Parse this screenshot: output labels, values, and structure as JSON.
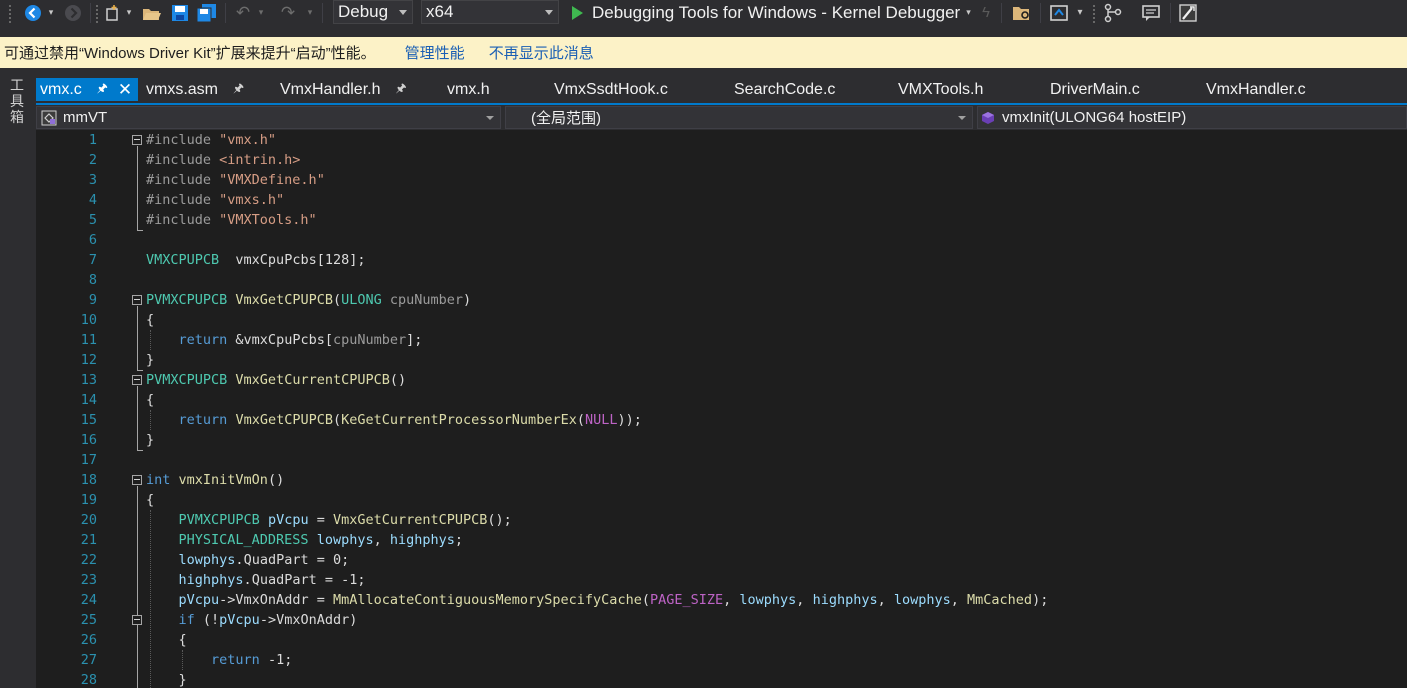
{
  "toolbar": {
    "config": "Debug",
    "platform": "x64",
    "debugger": "Debugging Tools for Windows - Kernel Debugger"
  },
  "infobar": {
    "message": "可通过禁用“Windows Driver Kit”扩展来提升“启动”性能。",
    "manage_link": "管理性能",
    "dismiss_link": "不再显示此消息"
  },
  "sidestrip": {
    "toolbox_label": "工具箱"
  },
  "tabs": [
    {
      "label": "vmx.c",
      "active": true
    },
    {
      "label": "vmxs.asm",
      "pinned": true
    },
    {
      "label": "VmxHandler.h",
      "pinned": true
    },
    {
      "label": "vmx.h"
    },
    {
      "label": "VmxSsdtHook.c"
    },
    {
      "label": "SearchCode.c"
    },
    {
      "label": "VMXTools.h"
    },
    {
      "label": "DriverMain.c"
    },
    {
      "label": "VmxHandler.c"
    }
  ],
  "navbar": {
    "project": "mmVT",
    "scope": "(全局范围)",
    "member": "vmxInit(ULONG64 hostEIP)"
  },
  "code": {
    "line_numbers": [
      "1",
      "2",
      "3",
      "4",
      "5",
      "6",
      "7",
      "8",
      "9",
      "10",
      "11",
      "12",
      "13",
      "14",
      "15",
      "16",
      "17",
      "18",
      "19",
      "20",
      "21",
      "22",
      "23",
      "24",
      "25",
      "26",
      "27",
      "28"
    ],
    "lines": [
      [
        [
          "pre",
          "#include "
        ],
        [
          "str",
          "\"vmx.h\""
        ]
      ],
      [
        [
          "pre",
          "#include "
        ],
        [
          "str",
          "<intrin.h>"
        ]
      ],
      [
        [
          "pre",
          "#include "
        ],
        [
          "str",
          "\"VMXDefine.h\""
        ]
      ],
      [
        [
          "pre",
          "#include "
        ],
        [
          "str",
          "\"vmxs.h\""
        ]
      ],
      [
        [
          "pre",
          "#include "
        ],
        [
          "str",
          "\"VMXTools.h\""
        ]
      ],
      [],
      [
        [
          "ty",
          "VMXCPUPCB"
        ],
        [
          "",
          "  "
        ],
        [
          "",
          "vmxCpuPcbs[128];"
        ]
      ],
      [],
      [
        [
          "ty",
          "PVMXCPUPCB"
        ],
        [
          "",
          " "
        ],
        [
          "fn",
          "VmxGetCPUPCB"
        ],
        [
          "",
          "("
        ],
        [
          "ty",
          "ULONG"
        ],
        [
          "",
          " "
        ],
        [
          "pre",
          "cpuNumber"
        ],
        [
          "",
          ")"
        ]
      ],
      [
        [
          "",
          "{"
        ]
      ],
      [
        [
          "",
          "    "
        ],
        [
          "kw",
          "return"
        ],
        [
          "",
          " &vmxCpuPcbs["
        ],
        [
          "pre",
          "cpuNumber"
        ],
        [
          "",
          "];"
        ]
      ],
      [
        [
          "",
          "}"
        ]
      ],
      [
        [
          "ty",
          "PVMXCPUPCB"
        ],
        [
          "",
          " "
        ],
        [
          "fn",
          "VmxGetCurrentCPUPCB"
        ],
        [
          "",
          "()"
        ]
      ],
      [
        [
          "",
          "{"
        ]
      ],
      [
        [
          "",
          "    "
        ],
        [
          "kw",
          "return"
        ],
        [
          "",
          " "
        ],
        [
          "fn",
          "VmxGetCPUPCB"
        ],
        [
          "",
          "("
        ],
        [
          "fn",
          "KeGetCurrentProcessorNumberEx"
        ],
        [
          "",
          "("
        ],
        [
          "mac",
          "NULL"
        ],
        [
          "",
          "));"
        ]
      ],
      [
        [
          "",
          "}"
        ]
      ],
      [],
      [
        [
          "kw",
          "int"
        ],
        [
          "",
          " "
        ],
        [
          "fn",
          "vmxInitVmOn"
        ],
        [
          "",
          "()"
        ]
      ],
      [
        [
          "",
          "{"
        ]
      ],
      [
        [
          "",
          "    "
        ],
        [
          "ty",
          "PVMXCPUPCB"
        ],
        [
          "",
          " "
        ],
        [
          "var",
          "pVcpu"
        ],
        [
          "",
          " = "
        ],
        [
          "fn",
          "VmxGetCurrentCPUPCB"
        ],
        [
          "",
          "();"
        ]
      ],
      [
        [
          "",
          "    "
        ],
        [
          "ty",
          "PHYSICAL_ADDRESS"
        ],
        [
          "",
          " "
        ],
        [
          "var",
          "lowphys"
        ],
        [
          "",
          ", "
        ],
        [
          "var",
          "highphys"
        ],
        [
          "",
          ";"
        ]
      ],
      [
        [
          "",
          "    "
        ],
        [
          "var",
          "lowphys"
        ],
        [
          "",
          "."
        ],
        [
          "fld",
          "QuadPart"
        ],
        [
          "",
          " = 0;"
        ]
      ],
      [
        [
          "",
          "    "
        ],
        [
          "var",
          "highphys"
        ],
        [
          "",
          "."
        ],
        [
          "fld",
          "QuadPart"
        ],
        [
          "",
          " = -1;"
        ]
      ],
      [
        [
          "",
          "    "
        ],
        [
          "var",
          "pVcpu"
        ],
        [
          "",
          "->"
        ],
        [
          "fld",
          "VmxOnAddr"
        ],
        [
          "",
          " = "
        ],
        [
          "fn",
          "MmAllocateContiguousMemorySpecifyCache"
        ],
        [
          "",
          "("
        ],
        [
          "mac",
          "PAGE_SIZE"
        ],
        [
          "",
          ", "
        ],
        [
          "var",
          "lowphys"
        ],
        [
          "",
          ", "
        ],
        [
          "var",
          "highphys"
        ],
        [
          "",
          ", "
        ],
        [
          "var",
          "lowphys"
        ],
        [
          "",
          ", "
        ],
        [
          "fn",
          "MmCached"
        ],
        [
          "",
          ");"
        ]
      ],
      [
        [
          "",
          "    "
        ],
        [
          "kw",
          "if"
        ],
        [
          "",
          " (!"
        ],
        [
          "var",
          "pVcpu"
        ],
        [
          "",
          "->"
        ],
        [
          "fld",
          "VmxOnAddr"
        ],
        [
          "",
          ")"
        ]
      ],
      [
        [
          "",
          "    {"
        ]
      ],
      [
        [
          "",
          "        "
        ],
        [
          "kw",
          "return"
        ],
        [
          "",
          " -1;"
        ]
      ],
      [
        [
          "",
          "    }"
        ]
      ]
    ]
  },
  "colors": {
    "accent": "#007acc",
    "editor_bg": "#1e1e1e",
    "chrome_bg": "#2d2d30",
    "infobar_bg": "#fcf2c7",
    "line_number": "#2b91af",
    "keyword": "#569cd6",
    "type": "#4ec9b0",
    "string": "#d69d85",
    "macro": "#bd63c5",
    "function": "#dcdcaa",
    "variable": "#9cdcfe",
    "preprocessor": "#9b9b9b"
  },
  "icons": [
    "back-icon",
    "forward-icon",
    "new-project-icon",
    "open-file-icon",
    "save-icon",
    "save-all-icon",
    "undo-icon",
    "redo-icon",
    "start-debug-icon",
    "hot-reload-icon",
    "find-in-files-icon",
    "solution-explorer-icon",
    "attach-icon",
    "comment-icon",
    "wizard-icon",
    "pin-icon",
    "close-icon",
    "class-icon"
  ]
}
